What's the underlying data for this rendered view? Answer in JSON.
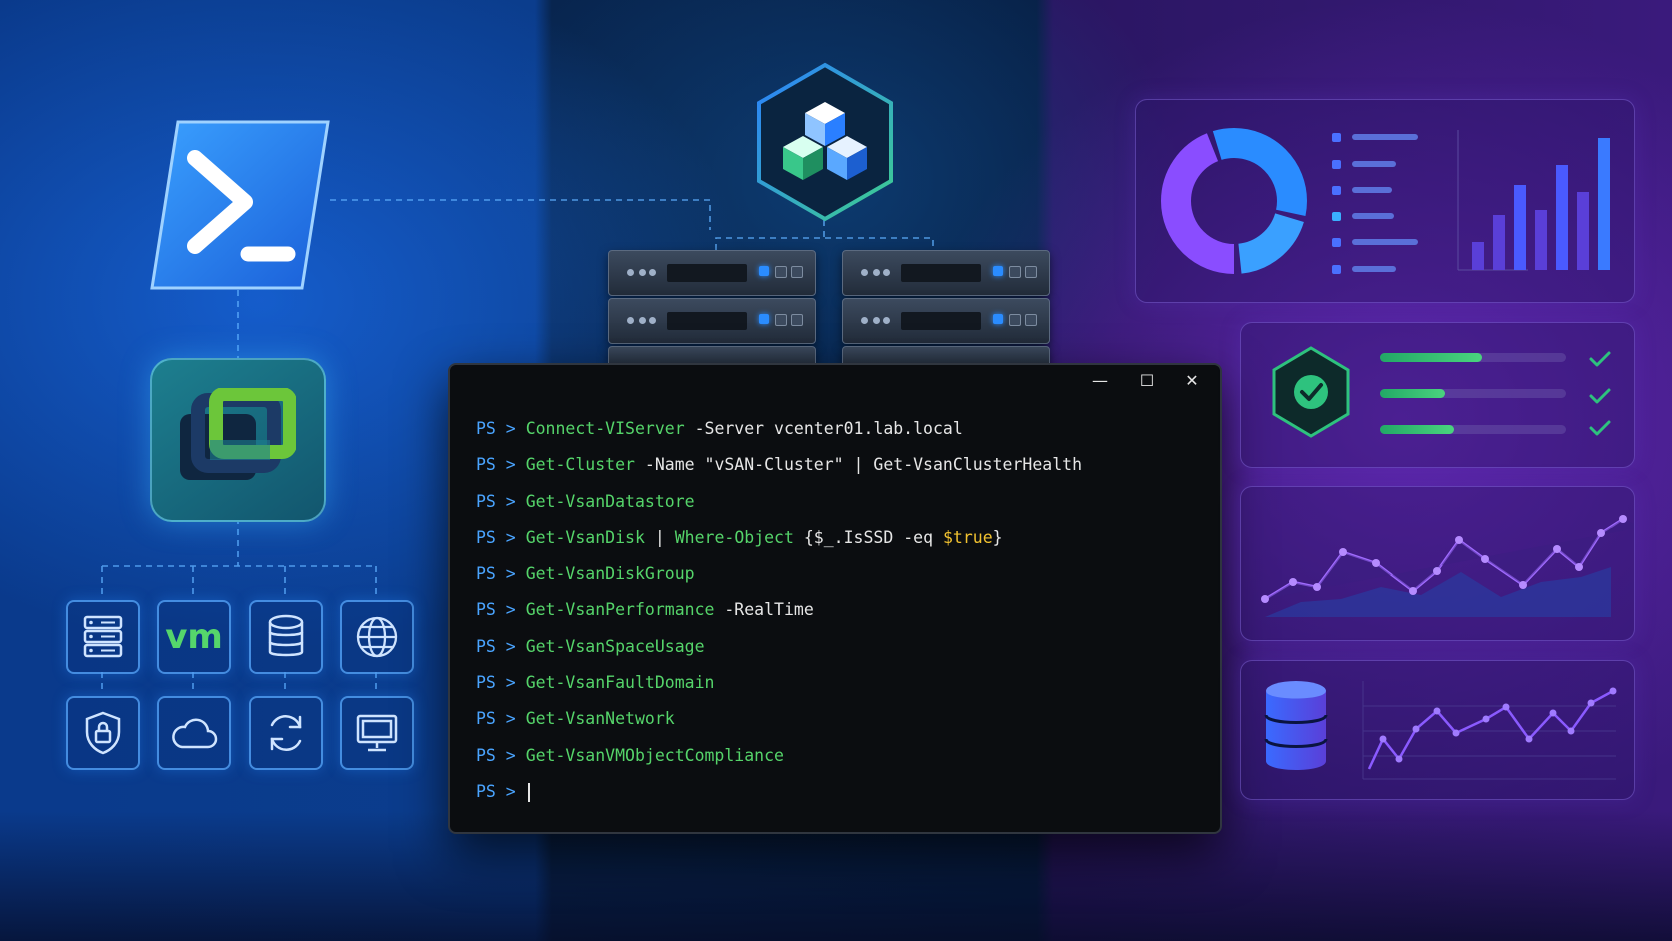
{
  "terminal": {
    "window_controls": {
      "minimize": "—",
      "maximize": "☐",
      "close": "✕"
    },
    "prompt": "PS >",
    "lines": [
      {
        "cmd": "Connect-VIServer",
        "rest": " -Server vcenter01.lab.local"
      },
      {
        "cmd": "Get-Cluster",
        "rest": " -Name \"vSAN-Cluster\" | ",
        "cmd2": "Get-VsanClusterHealth",
        "rest2": ""
      },
      {
        "cmd": "Get-VsanDatastore",
        "rest": ""
      },
      {
        "cmd": "Get-VsanDisk",
        "rest": " | ",
        "cmd2": "Where-Object",
        "rest2": " {$_.IsSSD -eq ",
        "kw": "$true",
        "rest3": "}"
      },
      {
        "cmd": "Get-VsanDiskGroup",
        "rest": ""
      },
      {
        "cmd": "Get-VsanPerformance",
        "rest": " -RealTime"
      },
      {
        "cmd": "Get-VsanSpaceUsage",
        "rest": ""
      },
      {
        "cmd": "Get-VsanFaultDomain",
        "rest": ""
      },
      {
        "cmd": "Get-VsanNetwork",
        "rest": ""
      },
      {
        "cmd": "Get-VsanVMObjectCompliance",
        "rest": ""
      }
    ],
    "cursor_line_prompt": "PS >"
  },
  "left": {
    "vm_label": "vm",
    "icons": [
      "server-list-icon",
      "vm-icon",
      "database-icon",
      "globe-icon",
      "shield-lock-icon",
      "cloud-icon",
      "sync-icon",
      "monitor-icon"
    ]
  },
  "colors": {
    "accent_green": "#55d46a",
    "accent_blue": "#2a8cff",
    "accent_purple": "#8a4dff",
    "keyword_yellow": "#f2c230"
  },
  "health": {
    "progress": [
      0.55,
      0.35,
      0.4
    ]
  }
}
